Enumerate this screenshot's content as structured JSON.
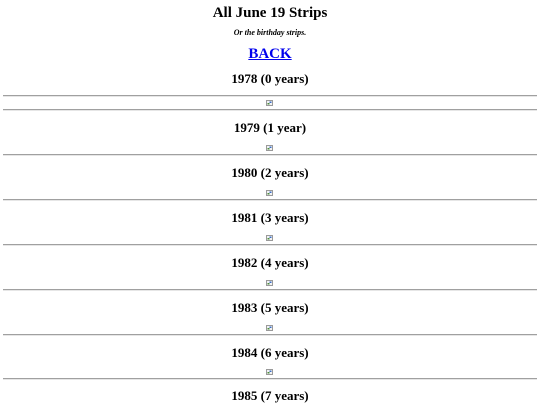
{
  "page": {
    "title": "All June 19 Strips",
    "subtitle": "Or the birthday strips.",
    "back_label": "BACK"
  },
  "strips": [
    {
      "heading": "1978 (0 years)",
      "image_icon": "broken-image-icon"
    },
    {
      "heading": "1979 (1 year)",
      "image_icon": "broken-image-icon"
    },
    {
      "heading": "1980 (2 years)",
      "image_icon": "broken-image-icon"
    },
    {
      "heading": "1981 (3 years)",
      "image_icon": "broken-image-icon"
    },
    {
      "heading": "1982 (4 years)",
      "image_icon": "broken-image-icon"
    },
    {
      "heading": "1983 (5 years)",
      "image_icon": "broken-image-icon"
    },
    {
      "heading": "1984 (6 years)",
      "image_icon": "broken-image-icon"
    },
    {
      "heading": "1985 (7 years)",
      "image_icon": "broken-image-icon"
    }
  ]
}
